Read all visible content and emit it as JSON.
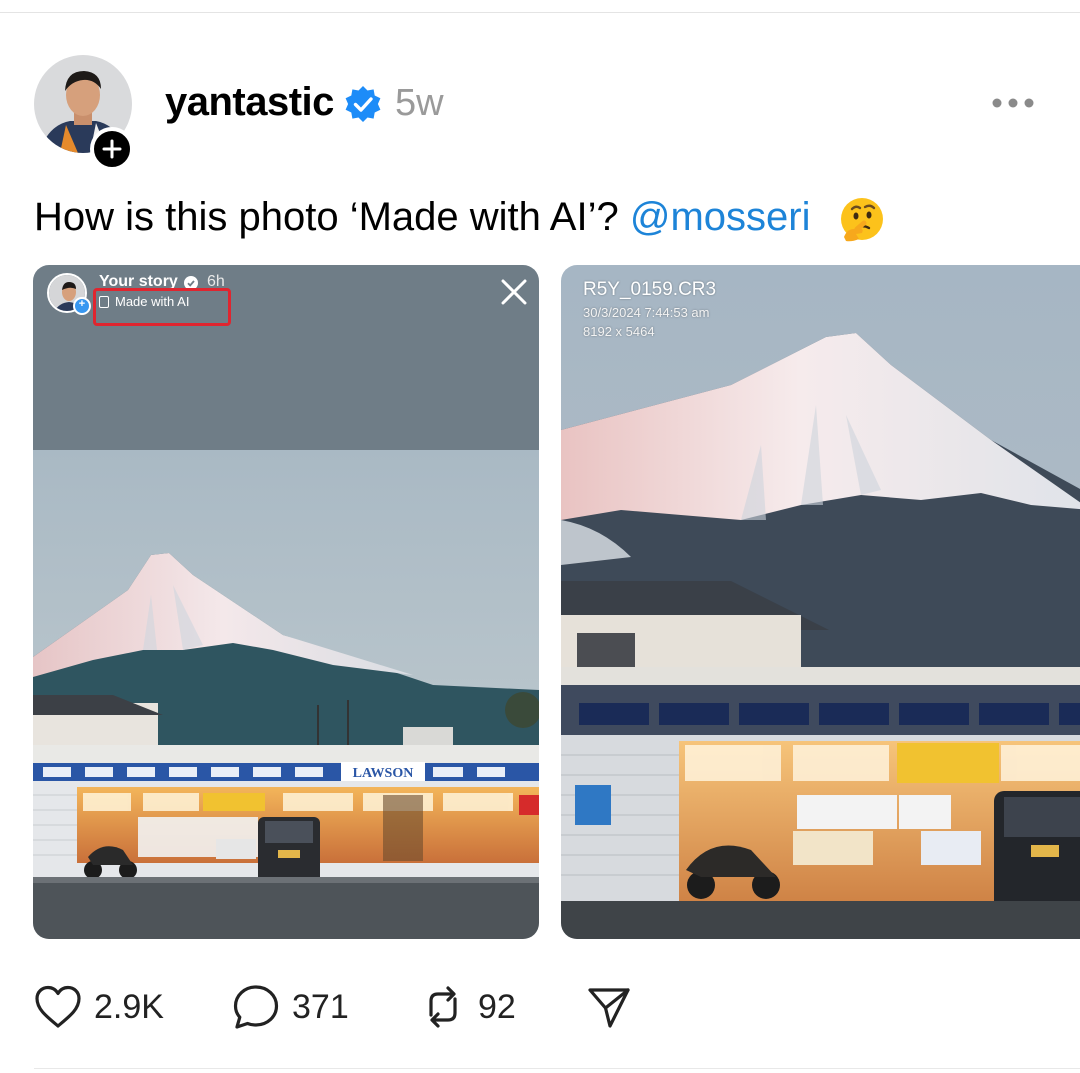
{
  "post": {
    "username": "yantastic",
    "time": "5w",
    "caption_text": "How is this photo ‘Made with AI’? ",
    "mention": "@mosseri",
    "emoji": "thinking-face"
  },
  "story_screenshot": {
    "name": "Your story",
    "time": "6h",
    "ai_label": "Made with AI",
    "store_sign": "LAWSON",
    "highlight_color": "#e0252f"
  },
  "raw_photo": {
    "filename": "R5Y_0159.CR3",
    "datetime": "30/3/2024 7:44:53 am",
    "dimensions": "8192 x 5464"
  },
  "actions": {
    "likes": "2.9K",
    "comments": "371",
    "reposts": "92"
  },
  "colors": {
    "mention": "#1d84d8",
    "verified": "#1d8cf8",
    "muted": "#9a9a9a"
  }
}
